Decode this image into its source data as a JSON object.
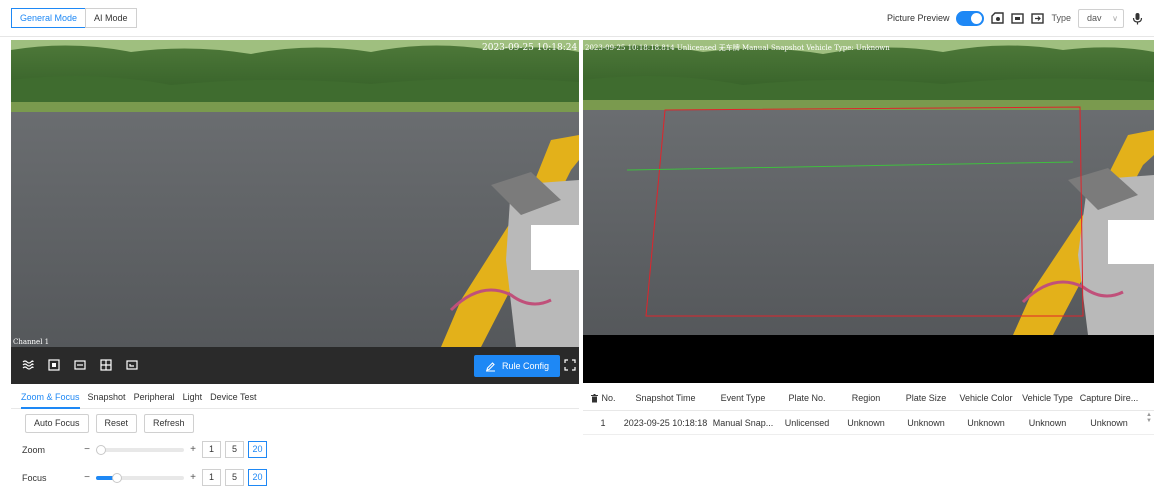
{
  "modes": {
    "general": "General Mode",
    "ai": "AI Mode"
  },
  "top_right": {
    "picture_preview_label": "Picture Preview",
    "type_label": "Type",
    "type_value": "dav"
  },
  "left_video": {
    "timestamp": "2023-09-25 10:18:24",
    "channel": "Channel 1"
  },
  "right_video": {
    "overlay_text": "2023-09-25 10:18:18.814 Unlicensed 无车牌  Manual Snapshot  Vehicle Type: Unknown"
  },
  "control_bar": {
    "rule_config": "Rule Config"
  },
  "tabs": [
    "Zoom & Focus",
    "Snapshot",
    "Peripheral",
    "Light",
    "Device Test"
  ],
  "buttons": {
    "auto_focus": "Auto Focus",
    "reset": "Reset",
    "refresh": "Refresh"
  },
  "zoom": {
    "label": "Zoom",
    "minus": "−",
    "plus": "+",
    "steps": [
      "1",
      "5",
      "20"
    ],
    "active_step": "20",
    "level": 0.0
  },
  "focus": {
    "label": "Focus",
    "minus": "−",
    "plus": "+",
    "steps": [
      "1",
      "5",
      "20"
    ],
    "active_step": "20",
    "level": 0.2
  },
  "table": {
    "columns": [
      "No.",
      "Snapshot Time",
      "Event Type",
      "Plate No.",
      "Region",
      "Plate Size",
      "Vehicle Color",
      "Vehicle Type",
      "Capture Dire..."
    ],
    "rows": [
      [
        "1",
        "2023-09-25 10:18:18",
        "Manual Snap...",
        "Unlicensed",
        "Unknown",
        "Unknown",
        "Unknown",
        "Unknown",
        "Unknown"
      ]
    ]
  },
  "colors": {
    "accent": "#1e88f5",
    "control_bar": "#2a2a2a",
    "detect_box": "#e0242b",
    "detect_line": "#3fbf3f"
  }
}
